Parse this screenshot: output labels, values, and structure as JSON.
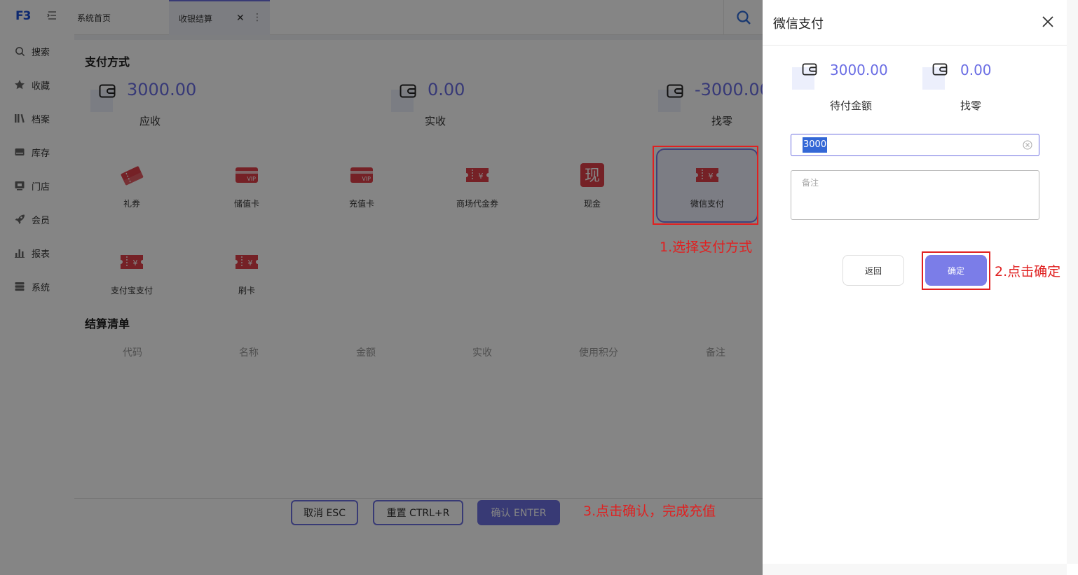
{
  "app": {
    "logo": "F3"
  },
  "sidebar": {
    "items": [
      {
        "label": "搜索",
        "icon": "search-icon"
      },
      {
        "label": "收藏",
        "icon": "star-icon"
      },
      {
        "label": "档案",
        "icon": "books-icon"
      },
      {
        "label": "库存",
        "icon": "inventory-icon"
      },
      {
        "label": "门店",
        "icon": "store-icon"
      },
      {
        "label": "会员",
        "icon": "rocket-icon"
      },
      {
        "label": "报表",
        "icon": "bar-chart-icon"
      },
      {
        "label": "系统",
        "icon": "server-icon"
      }
    ]
  },
  "tabs": {
    "home": "系统首页",
    "active": "收银结算"
  },
  "payment": {
    "title": "支付方式",
    "receivable": {
      "value": "3000.00",
      "label": "应收"
    },
    "received": {
      "value": "0.00",
      "label": "实收"
    },
    "change": {
      "value": "-3000.00",
      "label": "找零"
    },
    "methods": [
      {
        "label": "礼券",
        "icon": "gift-voucher-icon"
      },
      {
        "label": "储值卡",
        "icon": "vip-card-icon"
      },
      {
        "label": "充值卡",
        "icon": "recharge-card-icon"
      },
      {
        "label": "商场代金券",
        "icon": "mall-voucher-icon"
      },
      {
        "label": "现金",
        "icon": "cash-icon",
        "glyph": "现"
      },
      {
        "label": "微信支付",
        "icon": "wechat-pay-icon",
        "selected": true
      },
      {
        "label": "支付宝支付",
        "icon": "alipay-icon"
      },
      {
        "label": "刷卡",
        "icon": "card-swipe-icon"
      }
    ]
  },
  "settlement": {
    "title": "结算清单",
    "columns": [
      "代码",
      "名称",
      "金额",
      "实收",
      "使用积分",
      "备注"
    ]
  },
  "footer": {
    "cancel": "取消 ESC",
    "reset": "重置 CTRL+R",
    "confirm": "确认 ENTER"
  },
  "drawer": {
    "title": "微信支付",
    "pending": {
      "value": "3000.00",
      "label": "待付金额"
    },
    "change": {
      "value": "0.00",
      "label": "找零"
    },
    "amount_input": "3000",
    "note_placeholder": "备注",
    "back": "返回",
    "ok": "确定"
  },
  "annotations": {
    "step1": "1.选择支付方式",
    "step2": "2.点击确定",
    "step3": "3.点击确认，完成充值"
  },
  "colors": {
    "accent": "#6c6fe0",
    "amount": "#6a6de4",
    "pay_icon": "#e0404a",
    "annotation": "#e02020"
  }
}
